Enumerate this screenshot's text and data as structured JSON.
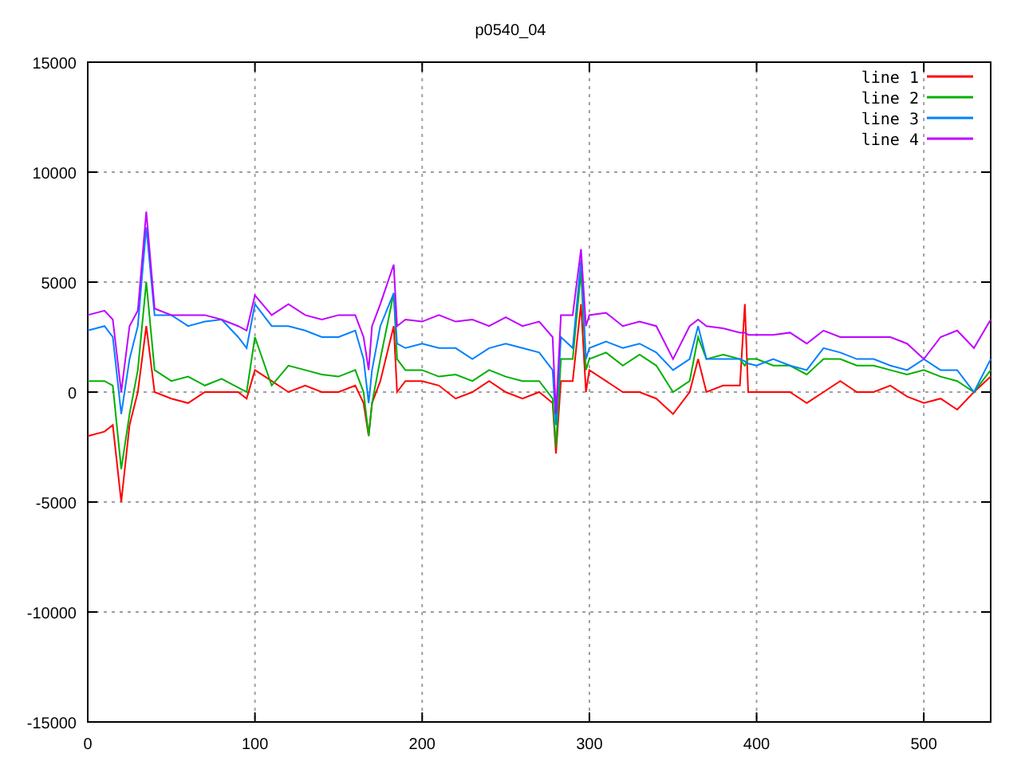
{
  "chart": {
    "chart_data": {
      "type": "line",
      "title": "p0540_04",
      "x": [
        0,
        10,
        15,
        20,
        25,
        30,
        35,
        40,
        50,
        60,
        70,
        80,
        90,
        95,
        100,
        110,
        120,
        130,
        140,
        150,
        160,
        165,
        168,
        170,
        175,
        183,
        185,
        190,
        200,
        210,
        220,
        230,
        240,
        250,
        260,
        270,
        278,
        280,
        283,
        290,
        295,
        298,
        300,
        310,
        320,
        330,
        340,
        350,
        360,
        365,
        370,
        380,
        390,
        393,
        395,
        400,
        410,
        420,
        430,
        440,
        450,
        460,
        470,
        480,
        490,
        500,
        510,
        520,
        530,
        540
      ],
      "series": [
        {
          "name": "line 1",
          "color": "#ff0000",
          "values": [
            -2000,
            -1800,
            -1500,
            -5000,
            -1500,
            0,
            3000,
            0,
            -300,
            -500,
            0,
            0,
            0,
            -300,
            1000,
            500,
            0,
            300,
            0,
            0,
            300,
            -500,
            -2000,
            -500,
            500,
            3000,
            0,
            500,
            500,
            300,
            -300,
            0,
            500,
            0,
            -300,
            0,
            -500,
            -2800,
            500,
            500,
            4000,
            0,
            1000,
            500,
            0,
            0,
            -300,
            -1000,
            0,
            1500,
            0,
            300,
            300,
            4000,
            0,
            0,
            0,
            0,
            -500,
            0,
            500,
            0,
            0,
            300,
            -200,
            -500,
            -300,
            -800,
            0,
            700
          ]
        },
        {
          "name": "line 2",
          "color": "#00b000",
          "values": [
            500,
            500,
            300,
            -3500,
            -1000,
            1000,
            5000,
            1000,
            500,
            700,
            300,
            600,
            200,
            0,
            2500,
            300,
            1200,
            1000,
            800,
            700,
            1000,
            0,
            -2000,
            -500,
            1500,
            4500,
            1500,
            1000,
            1000,
            700,
            800,
            500,
            1000,
            700,
            500,
            500,
            -300,
            -2500,
            1500,
            1500,
            5500,
            1000,
            1500,
            1800,
            1200,
            1700,
            1200,
            0,
            500,
            2500,
            1500,
            1700,
            1500,
            1200,
            1500,
            1500,
            1200,
            1200,
            800,
            1500,
            1500,
            1200,
            1200,
            1000,
            800,
            1000,
            700,
            500,
            0,
            1000
          ]
        },
        {
          "name": "line 3",
          "color": "#0080ff",
          "values": [
            2800,
            3000,
            2500,
            -1000,
            1500,
            3000,
            7500,
            3500,
            3500,
            3000,
            3200,
            3300,
            2500,
            2000,
            4000,
            3000,
            3000,
            2800,
            2500,
            2500,
            2800,
            1500,
            -500,
            1000,
            3000,
            4500,
            2200,
            2000,
            2200,
            2000,
            2000,
            1500,
            2000,
            2200,
            2000,
            1800,
            1000,
            -1500,
            2500,
            2000,
            6000,
            1500,
            2000,
            2300,
            2000,
            2200,
            1800,
            1000,
            1500,
            3000,
            1500,
            1500,
            1500,
            1400,
            1300,
            1200,
            1500,
            1200,
            1000,
            2000,
            1800,
            1500,
            1500,
            1200,
            1000,
            1500,
            1000,
            1000,
            0,
            1500
          ]
        },
        {
          "name": "line 4",
          "color": "#c000ff",
          "values": [
            3500,
            3700,
            3300,
            0,
            3000,
            3700,
            8200,
            3800,
            3500,
            3500,
            3500,
            3300,
            3000,
            2800,
            4400,
            3500,
            4000,
            3500,
            3300,
            3500,
            3500,
            2500,
            1000,
            3000,
            4000,
            5800,
            3000,
            3300,
            3200,
            3500,
            3200,
            3300,
            3000,
            3400,
            3000,
            3200,
            2500,
            -1000,
            3500,
            3500,
            6500,
            3000,
            3500,
            3600,
            3000,
            3200,
            3000,
            1500,
            3000,
            3300,
            3000,
            2900,
            2700,
            2700,
            2600,
            2600,
            2600,
            2700,
            2200,
            2800,
            2500,
            2500,
            2500,
            2500,
            2200,
            1500,
            2500,
            2800,
            2000,
            3300
          ]
        }
      ],
      "grid": true,
      "legend": true,
      "xlim": [
        0,
        540
      ],
      "ylim": [
        -15000,
        15000
      ],
      "xticks": [
        0,
        100,
        200,
        300,
        400,
        500
      ],
      "yticks": [
        -15000,
        -10000,
        -5000,
        0,
        5000,
        10000,
        15000
      ]
    }
  }
}
